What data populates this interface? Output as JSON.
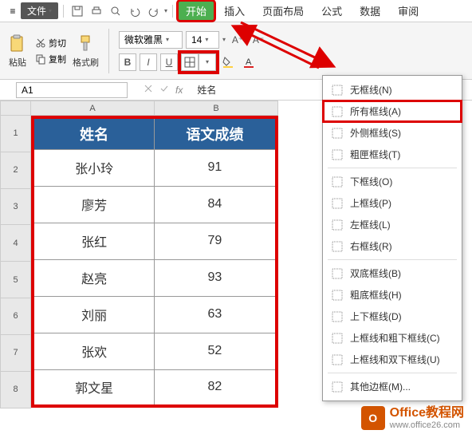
{
  "menubar": {
    "menu_icon": "≡",
    "file_label": "文件",
    "tabs": {
      "start": "开始",
      "insert": "插入",
      "layout": "页面布局",
      "formula": "公式",
      "data": "数据",
      "review": "审阅"
    }
  },
  "ribbon": {
    "paste": "粘贴",
    "cut": "剪切",
    "copy": "复制",
    "format_painter": "格式刷",
    "font_name": "微软雅黑",
    "font_size": "14",
    "bold": "B",
    "italic": "I",
    "underline": "U"
  },
  "namebox": {
    "cell": "A1",
    "fx": "fx",
    "value": "姓名"
  },
  "columns": {
    "A": "A",
    "B": "B"
  },
  "rows": [
    "1",
    "2",
    "3",
    "4",
    "5",
    "6",
    "7",
    "8"
  ],
  "table": {
    "header": {
      "name": "姓名",
      "score": "语文成绩"
    },
    "data": [
      {
        "name": "张小玲",
        "score": "91"
      },
      {
        "name": "廖芳",
        "score": "84"
      },
      {
        "name": "张红",
        "score": "79"
      },
      {
        "name": "赵亮",
        "score": "93"
      },
      {
        "name": "刘丽",
        "score": "63"
      },
      {
        "name": "张欢",
        "score": "52"
      },
      {
        "name": "郭文星",
        "score": "82"
      }
    ]
  },
  "borders_menu": [
    {
      "label": "无框线(N)",
      "hl": false
    },
    {
      "label": "所有框线(A)",
      "hl": true
    },
    {
      "label": "外侧框线(S)",
      "hl": false
    },
    {
      "label": "粗匣框线(T)",
      "hl": false
    },
    {
      "sep": true
    },
    {
      "label": "下框线(O)",
      "hl": false
    },
    {
      "label": "上框线(P)",
      "hl": false
    },
    {
      "label": "左框线(L)",
      "hl": false
    },
    {
      "label": "右框线(R)",
      "hl": false
    },
    {
      "sep": true
    },
    {
      "label": "双底框线(B)",
      "hl": false
    },
    {
      "label": "粗底框线(H)",
      "hl": false
    },
    {
      "label": "上下框线(D)",
      "hl": false
    },
    {
      "label": "上框线和粗下框线(C)",
      "hl": false
    },
    {
      "label": "上框线和双下框线(U)",
      "hl": false
    },
    {
      "sep": true
    },
    {
      "label": "其他边框(M)...",
      "hl": false
    }
  ],
  "watermark": {
    "line1": "Office教程网",
    "line2": "www.office26.com"
  }
}
